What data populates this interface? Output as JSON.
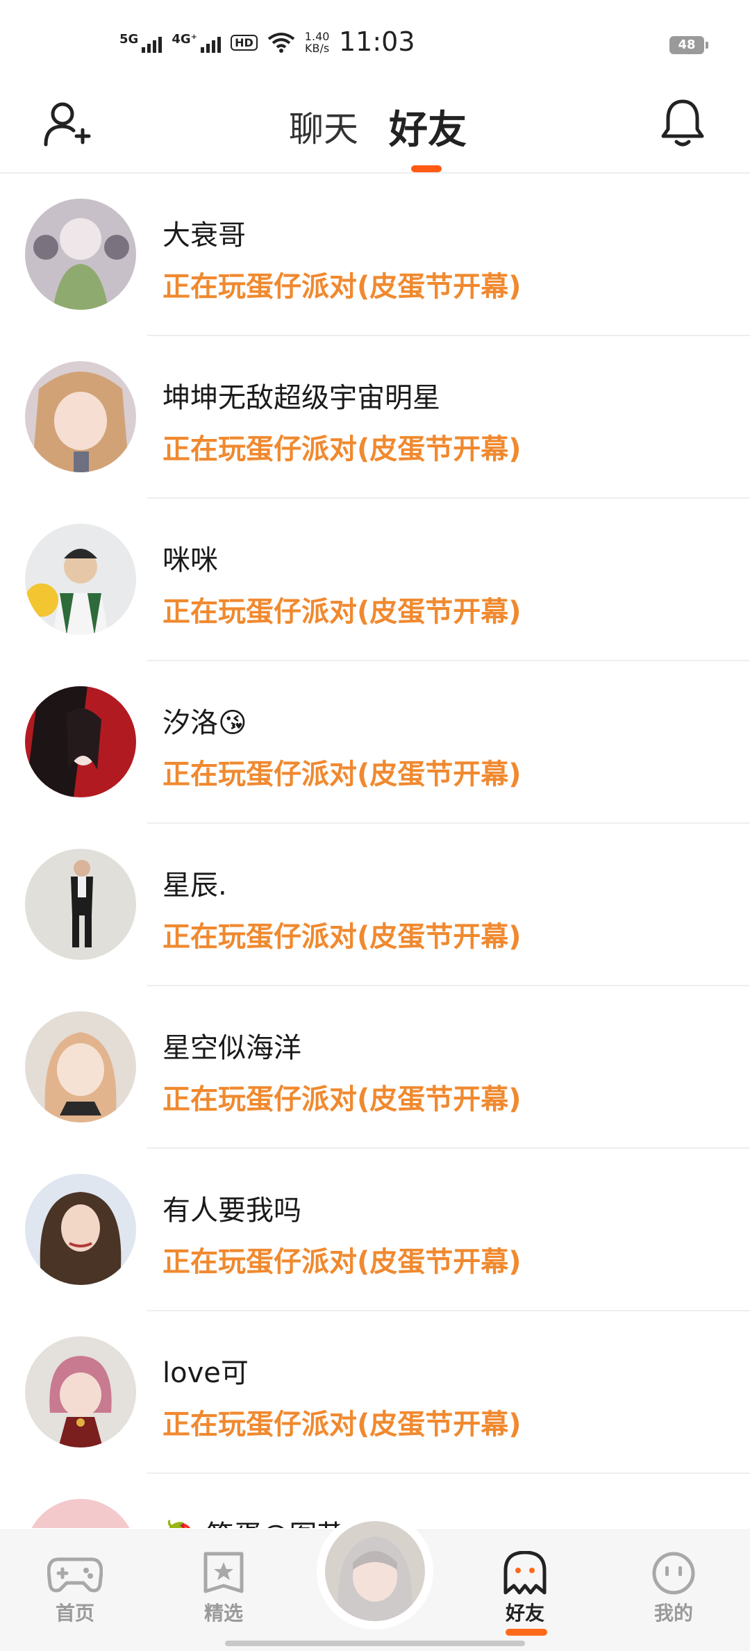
{
  "status_bar": {
    "net1": "5G",
    "net2": "4G⁺",
    "hd": "HD",
    "speed_value": "1.40",
    "speed_unit": "KB/s",
    "time": "11:03",
    "battery": "48"
  },
  "top_nav": {
    "tabs": [
      {
        "label": "聊天",
        "active": false
      },
      {
        "label": "好友",
        "active": true
      }
    ]
  },
  "friends": [
    {
      "name": "大衰哥",
      "status": "正在玩蛋仔派对(皮蛋节开幕)"
    },
    {
      "name": "坤坤无敌超级宇宙明星",
      "status": "正在玩蛋仔派对(皮蛋节开幕)"
    },
    {
      "name": "咪咪",
      "status": "正在玩蛋仔派对(皮蛋节开幕)"
    },
    {
      "name": "汐洛😘",
      "status": "正在玩蛋仔派对(皮蛋节开幕)"
    },
    {
      "name": "星辰.",
      "status": "正在玩蛋仔派对(皮蛋节开幕)"
    },
    {
      "name": "星空似海洋",
      "status": "正在玩蛋仔派对(皮蛋节开幕)"
    },
    {
      "name": "有人要我吗",
      "status": "正在玩蛋仔派对(皮蛋节开幕)"
    },
    {
      "name": "love可",
      "status": "正在玩蛋仔派对(皮蛋节开幕)"
    },
    {
      "name": "🍓 笨蛋@图苏",
      "status": ""
    }
  ],
  "bottom_nav": {
    "items": [
      {
        "label": "首页",
        "icon": "gamepad-icon",
        "active": false
      },
      {
        "label": "精选",
        "icon": "star-card-icon",
        "active": false
      },
      {
        "label": "好友",
        "icon": "ghost-icon",
        "active": true
      },
      {
        "label": "我的",
        "icon": "face-icon",
        "active": false
      }
    ]
  },
  "colors": {
    "accent": "#ff5a14",
    "status_text": "#f0892f"
  }
}
